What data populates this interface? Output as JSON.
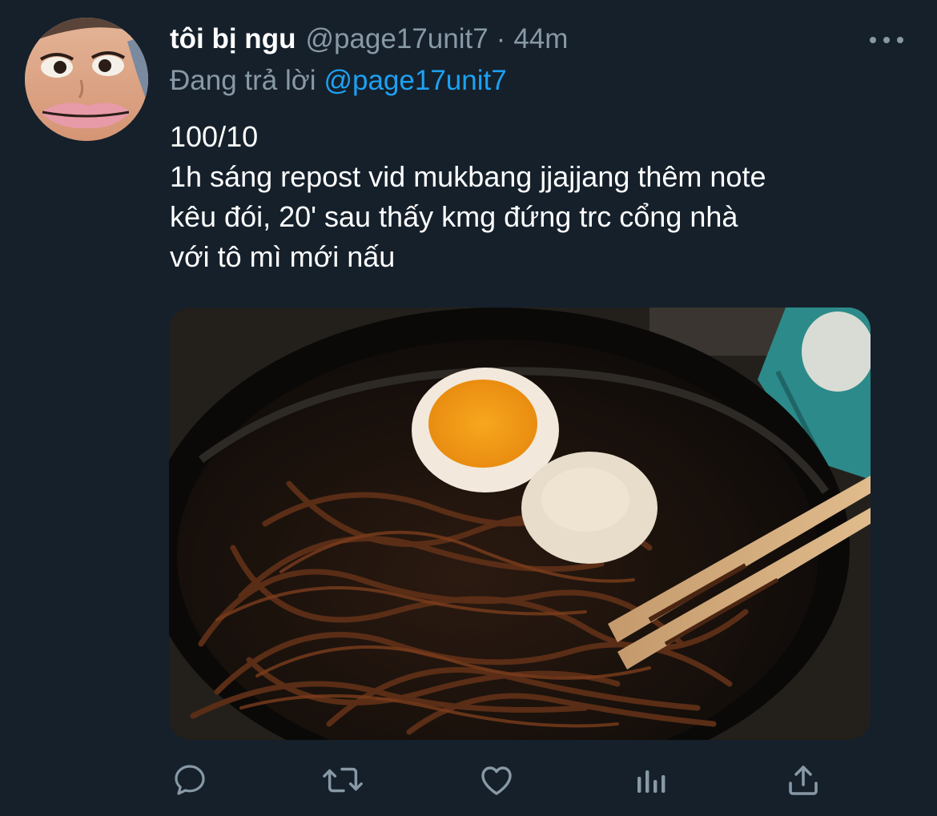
{
  "tweet": {
    "display_name": "tôi bị ngu",
    "handle": "@page17unit7",
    "separator": "·",
    "time": "44m",
    "reply_prefix": "Đang trả lời",
    "reply_mention": "@page17unit7",
    "body_lines": [
      "100/10",
      "1h sáng repost vid mukbang jjajjang thêm note",
      "kêu đói, 20' sau thấy kmg đứng trc cổng nhà",
      "với tô mì mới nấu"
    ],
    "more_icon": "more-horizontal-icon",
    "media_icon": "photo-jjajangmyeon-bowl"
  },
  "actions": [
    {
      "name": "reply",
      "icon": "reply-icon"
    },
    {
      "name": "retweet",
      "icon": "retweet-icon"
    },
    {
      "name": "like",
      "icon": "heart-icon"
    },
    {
      "name": "analytics",
      "icon": "analytics-icon"
    },
    {
      "name": "share",
      "icon": "share-icon"
    }
  ],
  "colors": {
    "background": "#15202b",
    "text": "#ffffff",
    "secondary": "#8899a6",
    "accent": "#1da1f2"
  }
}
